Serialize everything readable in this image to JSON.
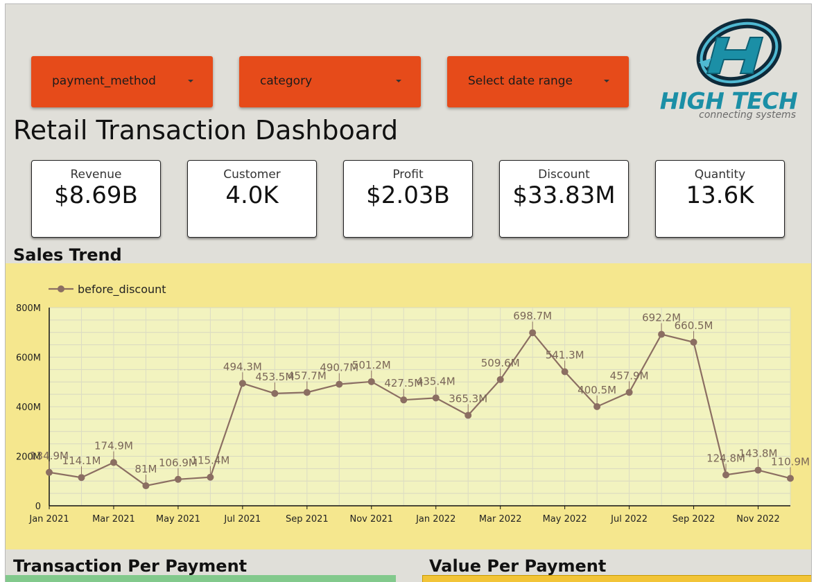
{
  "filters": [
    {
      "label": "payment_method"
    },
    {
      "label": "category"
    },
    {
      "label": "Select date range"
    }
  ],
  "logo": {
    "brand": "HIGH TECH",
    "tagline": "connecting systems"
  },
  "dashboard_title": "Retail Transaction Dashboard",
  "kpis": [
    {
      "label": "Revenue",
      "value": "$8.69B"
    },
    {
      "label": "Customer",
      "value": "4.0K"
    },
    {
      "label": "Profit",
      "value": "$2.03B"
    },
    {
      "label": "Discount",
      "value": "$33.83M"
    },
    {
      "label": "Quantity",
      "value": "13.6K"
    }
  ],
  "sections": {
    "sales_trend": "Sales Trend",
    "transaction_per_payment": "Transaction Per Payment",
    "value_per_payment": "Value Per Payment"
  },
  "colors": {
    "filter_bg": "#e64b1a",
    "chart_bg": "#f5e78e",
    "plot_bg": "#f2f3bf",
    "series": "#8b6e62",
    "teal": "#1b8fa6"
  },
  "chart_data": {
    "type": "line",
    "title": "",
    "legend": "top-left",
    "grid": true,
    "ylim": [
      0,
      800000000
    ],
    "yticks": [
      {
        "value": 0,
        "label": "0"
      },
      {
        "value": 200000000,
        "label": "200M"
      },
      {
        "value": 400000000,
        "label": "400M"
      },
      {
        "value": 600000000,
        "label": "600M"
      },
      {
        "value": 800000000,
        "label": "800M"
      }
    ],
    "xtick_labels": [
      {
        "index": 0,
        "label": "Jan 2021"
      },
      {
        "index": 2,
        "label": "Mar 2021"
      },
      {
        "index": 4,
        "label": "May 2021"
      },
      {
        "index": 6,
        "label": "Jul 2021"
      },
      {
        "index": 8,
        "label": "Sep 2021"
      },
      {
        "index": 10,
        "label": "Nov 2021"
      },
      {
        "index": 12,
        "label": "Jan 2022"
      },
      {
        "index": 14,
        "label": "Mar 2022"
      },
      {
        "index": 16,
        "label": "May 2022"
      },
      {
        "index": 18,
        "label": "Jul 2022"
      },
      {
        "index": 20,
        "label": "Sep 2022"
      },
      {
        "index": 22,
        "label": "Nov 2022"
      }
    ],
    "series": [
      {
        "name": "before_discount",
        "values": [
          134900000,
          114100000,
          174900000,
          81000000,
          106900000,
          115400000,
          494300000,
          453500000,
          457700000,
          490700000,
          501200000,
          427500000,
          435400000,
          365300000,
          509600000,
          698700000,
          541300000,
          400500000,
          457900000,
          692200000,
          660500000,
          124800000,
          143800000,
          110900000
        ],
        "labels": [
          "134.9M",
          "114.1M",
          "174.9M",
          "81M",
          "106.9M",
          "115.4M",
          "494.3M",
          "453.5M",
          "457.7M",
          "490.7M",
          "501.2M",
          "427.5M",
          "435.4M",
          "365.3M",
          "509.6M",
          "698.7M",
          "541.3M",
          "400.5M",
          "457.9M",
          "692.2M",
          "660.5M",
          "124.8M",
          "143.8M",
          "110.9M"
        ]
      }
    ]
  }
}
